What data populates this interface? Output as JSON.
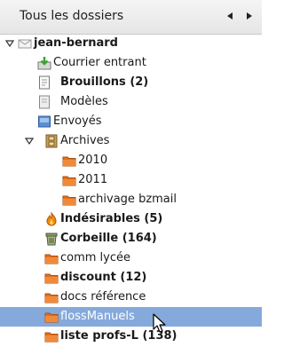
{
  "header": {
    "title": "Tous les dossiers",
    "prev_icon": "triangle-left-icon",
    "next_icon": "triangle-right-icon"
  },
  "tree": {
    "account": {
      "label": "jean-bernard"
    },
    "items": [
      {
        "label": "Courrier entrant",
        "icon": "inbox-icon",
        "bold": false
      },
      {
        "label": "Brouillons (2)",
        "icon": "drafts-icon",
        "bold": true
      },
      {
        "label": "Modèles",
        "icon": "templates-icon",
        "bold": false
      },
      {
        "label": "Envoyés",
        "icon": "sent-icon",
        "bold": false
      },
      {
        "label": "Archives",
        "icon": "archive-icon",
        "bold": false,
        "expanded": true
      },
      {
        "label": "2010",
        "icon": "folder-icon",
        "bold": false
      },
      {
        "label": "2011",
        "icon": "folder-icon",
        "bold": false
      },
      {
        "label": "archivage bzmail",
        "icon": "folder-icon",
        "bold": false
      },
      {
        "label": "Indésirables (5)",
        "icon": "junk-icon",
        "bold": true
      },
      {
        "label": "Corbeille (164)",
        "icon": "trash-icon",
        "bold": true
      },
      {
        "label": "comm lycée",
        "icon": "folder-icon",
        "bold": false
      },
      {
        "label": "discount (12)",
        "icon": "folder-icon",
        "bold": true
      },
      {
        "label": "docs référence",
        "icon": "folder-icon",
        "bold": false
      },
      {
        "label": "flossManuels",
        "icon": "folder-icon",
        "bold": false,
        "selected": true
      },
      {
        "label": "liste profs-L (138)",
        "icon": "folder-icon",
        "bold": true
      }
    ]
  },
  "colors": {
    "selection": "#86a9db",
    "folder": "#e4701c"
  }
}
